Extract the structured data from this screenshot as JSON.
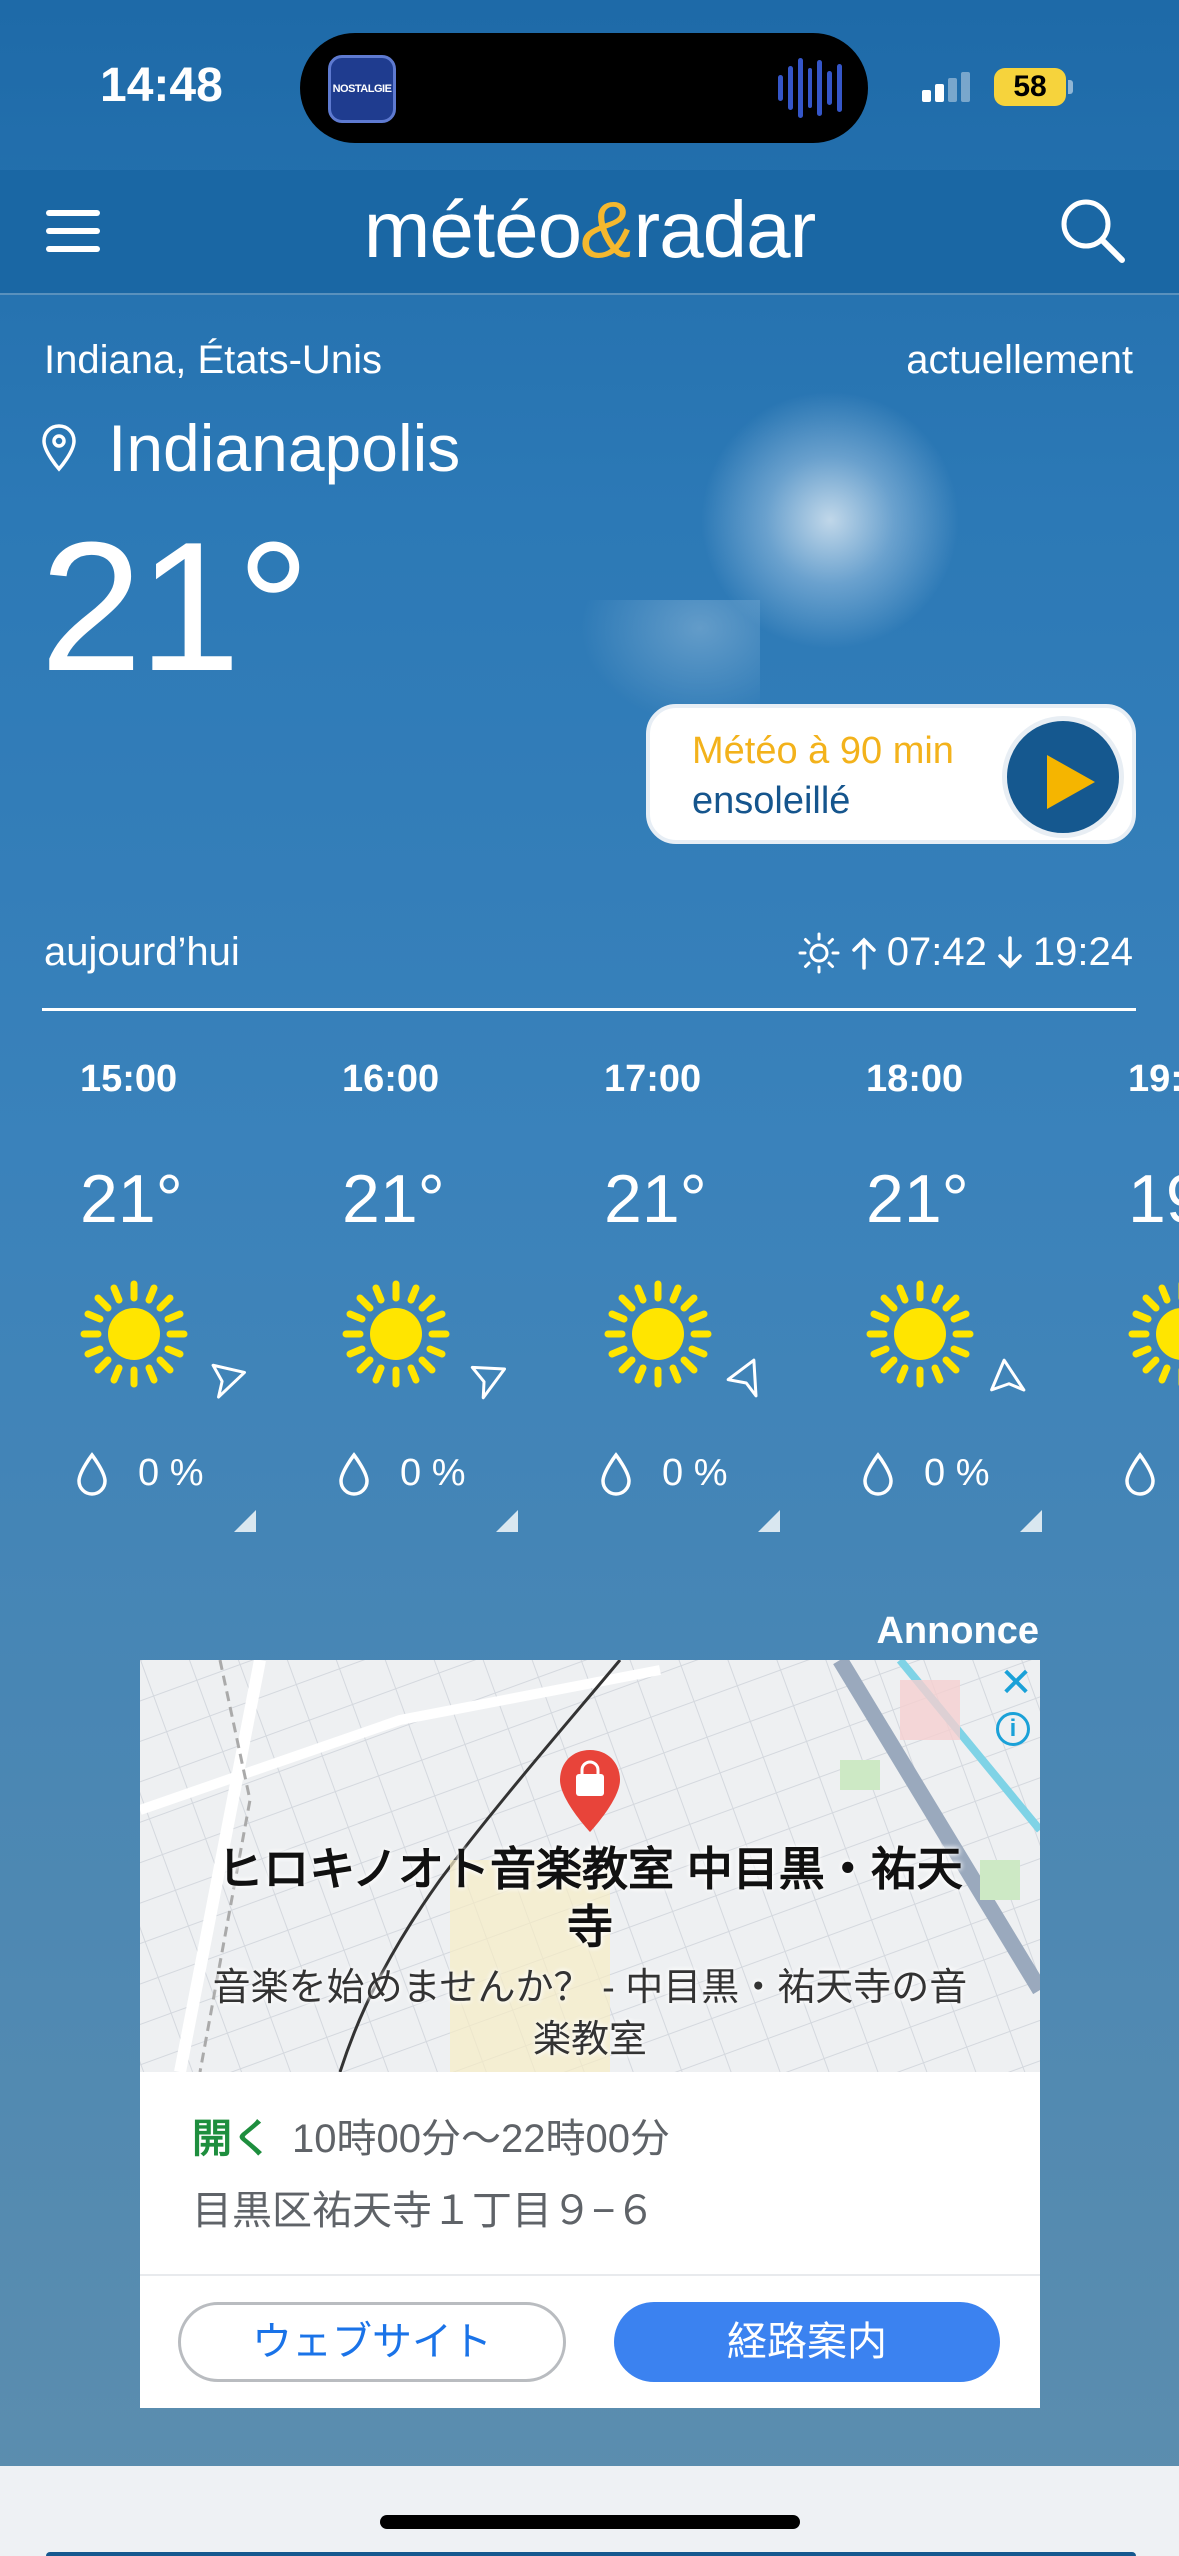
{
  "status_bar": {
    "time": "14:48",
    "battery": "58",
    "island_app": "NOSTALGIE"
  },
  "header": {
    "logo_left": "météo",
    "logo_amp": "&",
    "logo_right": "radar"
  },
  "location": {
    "region": "Indiana, États-Unis",
    "updated": "actuellement",
    "city": "Indianapolis",
    "temperature": "21°"
  },
  "nowcast": {
    "title": "Météo à 90 min",
    "condition": "ensoleillé"
  },
  "today": {
    "label": "aujourd’hui",
    "sunrise": "07:42",
    "sunset": "19:24"
  },
  "hourly": [
    {
      "time": "15:00",
      "temp": "21°",
      "pop": "0 %",
      "wind_deg": 20
    },
    {
      "time": "16:00",
      "temp": "21°",
      "pop": "0 %",
      "wind_deg": 10
    },
    {
      "time": "17:00",
      "temp": "21°",
      "pop": "0 %",
      "wind_deg": -30
    },
    {
      "time": "18:00",
      "temp": "21°",
      "pop": "0 %",
      "wind_deg": -60
    },
    {
      "time": "19:",
      "temp": "19",
      "pop": "",
      "wind_deg": 0
    }
  ],
  "ad": {
    "label": "Annonce",
    "title": "ヒロキノオト音楽教室 中目黒・祐天寺",
    "description": "音楽を始めませんか？ - 中目黒・祐天寺の音楽教室",
    "open_label": "開く",
    "hours": "10時00分〜22時00分",
    "address": "目黒区祐天寺１丁目９−６",
    "website_button": "ウェブサイト",
    "route_button": "経路案内"
  },
  "colors": {
    "accent_yellow": "#f3b21b",
    "brand_blue": "#15588f",
    "sun": "#ffe500"
  }
}
